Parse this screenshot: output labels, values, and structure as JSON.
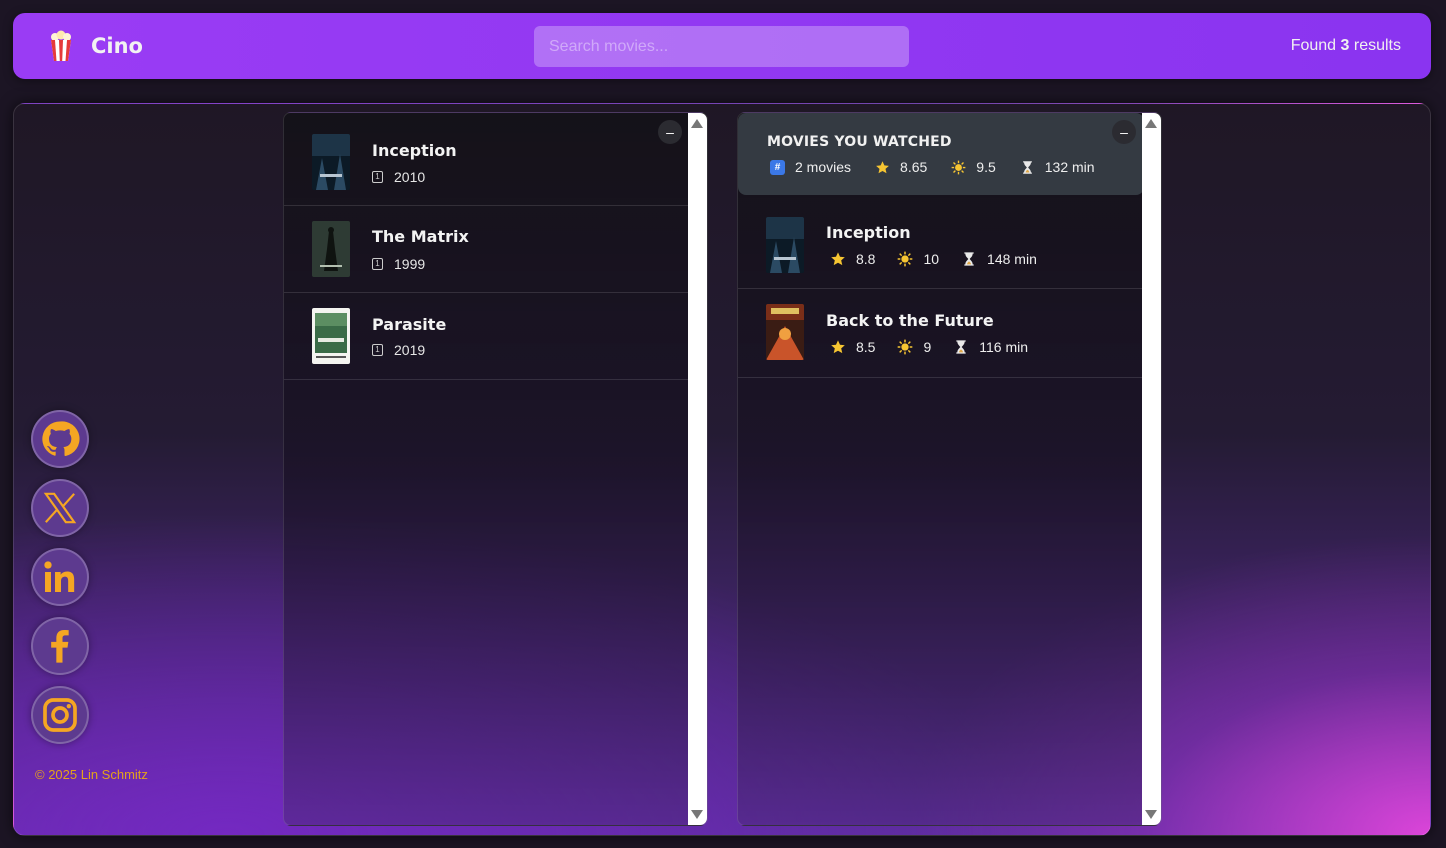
{
  "app": {
    "name": "Cino"
  },
  "search": {
    "placeholder": "Search movies..."
  },
  "results": {
    "prefix": "Found",
    "count": "3",
    "suffix": "results"
  },
  "search_results": [
    {
      "title": "Inception",
      "year": "2010"
    },
    {
      "title": "The Matrix",
      "year": "1999"
    },
    {
      "title": "Parasite",
      "year": "2019"
    }
  ],
  "summary": {
    "heading": "MOVIES YOU WATCHED",
    "movies": "2 movies",
    "imdb_avg": "8.65",
    "user_avg": "9.5",
    "runtime_avg": "132 min"
  },
  "watched": [
    {
      "title": "Inception",
      "imdb": "8.8",
      "user": "10",
      "runtime": "148 min"
    },
    {
      "title": "Back to the Future",
      "imdb": "8.5",
      "user": "9",
      "runtime": "116 min"
    }
  ],
  "toggle_label": "–",
  "footer": {
    "copyright": "© 2025 Lin Schmitz"
  },
  "social": [
    "github-icon",
    "x-icon",
    "linkedin-icon",
    "facebook-icon",
    "instagram-icon"
  ],
  "colors": {
    "accent": "#9a3cf4",
    "social_icon": "#f5a623",
    "copyright": "#e4a21b"
  }
}
